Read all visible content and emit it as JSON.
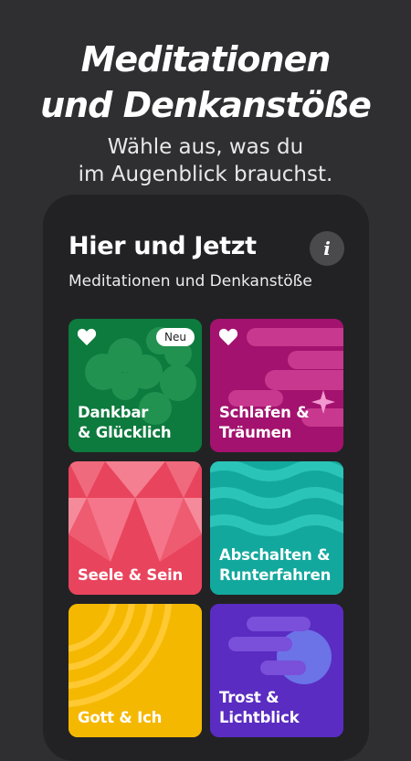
{
  "hero": {
    "title_line1": "Meditationen",
    "title_line2": "und Denkanstöße",
    "subtitle_line1": "Wähle aus, was du",
    "subtitle_line2": "im Augenblick brauchst."
  },
  "screen": {
    "title": "Hier und Jetzt",
    "subtitle": "Meditationen und Denkanstöße",
    "info_icon": "i"
  },
  "tiles": [
    {
      "line1": "Dankbar",
      "line2": "& Glücklich",
      "badge": "Neu",
      "favorite": true,
      "color": "#0d7a3e"
    },
    {
      "line1": "Schlafen &",
      "line2": "Träumen",
      "favorite": true,
      "color": "#a3126e"
    },
    {
      "line1": "Seele & Sein",
      "line2": "",
      "color": "#e9445d"
    },
    {
      "line1": "Abschalten &",
      "line2": "Runterfahren",
      "color": "#13a89d"
    },
    {
      "line1": "Gott & Ich",
      "line2": "",
      "color": "#f5b800"
    },
    {
      "line1": "Trost &",
      "line2": "Lichtblick",
      "color": "#5a2cc2"
    }
  ]
}
